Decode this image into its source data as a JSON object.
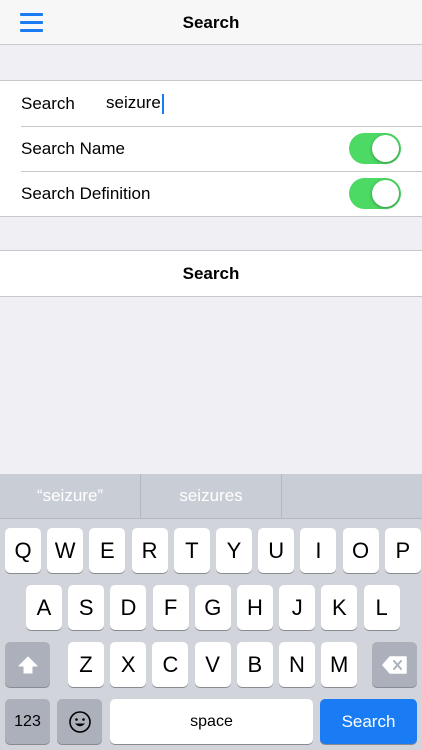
{
  "nav": {
    "title": "Search"
  },
  "form": {
    "search_label": "Search",
    "search_value": "seizure",
    "search_name_label": "Search Name",
    "search_definition_label": "Search Definition",
    "search_name_on": true,
    "search_definition_on": true,
    "submit_label": "Search"
  },
  "keyboard": {
    "suggestions": [
      "“seizure”",
      "seizures",
      ""
    ],
    "row1": [
      "Q",
      "W",
      "E",
      "R",
      "T",
      "Y",
      "U",
      "I",
      "O",
      "P"
    ],
    "row2": [
      "A",
      "S",
      "D",
      "F",
      "G",
      "H",
      "J",
      "K",
      "L"
    ],
    "row3": [
      "Z",
      "X",
      "C",
      "V",
      "B",
      "N",
      "M"
    ],
    "numbers_label": "123",
    "space_label": "space",
    "return_label": "Search"
  },
  "colors": {
    "accent": "#1a7cf4",
    "toggle_on": "#4cd964"
  }
}
